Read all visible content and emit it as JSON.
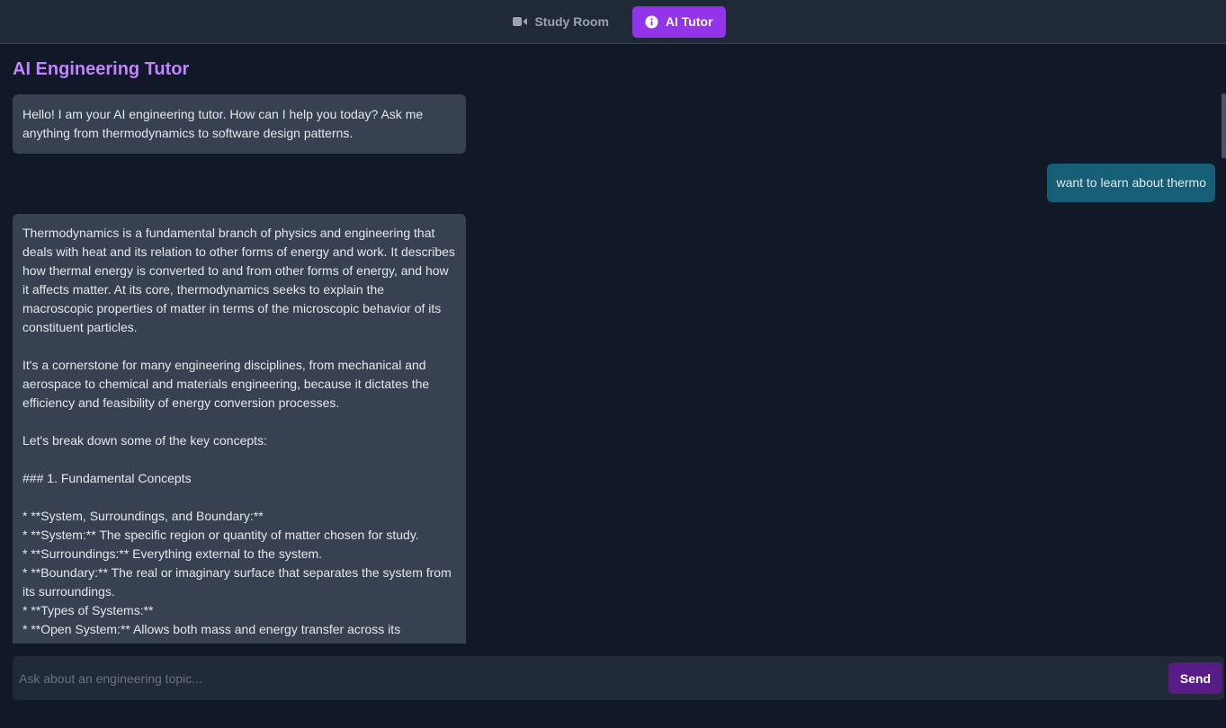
{
  "nav": {
    "tabs": [
      {
        "label": "Study Room",
        "icon": "video-camera-icon",
        "active": false
      },
      {
        "label": "AI Tutor",
        "icon": "info-circle-icon",
        "active": true
      }
    ]
  },
  "page": {
    "title": "AI Engineering Tutor"
  },
  "messages": [
    {
      "role": "assistant",
      "text": "Hello! I am your AI engineering tutor. How can I help you today? Ask me anything from thermodynamics to software design patterns."
    },
    {
      "role": "user",
      "text": "want to learn about thermo"
    },
    {
      "role": "assistant",
      "paragraphs": [
        "Thermodynamics is a fundamental branch of physics and engineering that deals with heat and its relation to other forms of energy and work. It describes how thermal energy is converted to and from other forms of energy, and how it affects matter. At its core, thermodynamics seeks to explain the macroscopic properties of matter in terms of the microscopic behavior of its constituent particles.",
        "It's a cornerstone for many engineering disciplines, from mechanical and aerospace to chemical and materials engineering, because it dictates the efficiency and feasibility of energy conversion processes.",
        "Let's break down some of the key concepts:",
        "### 1. Fundamental Concepts",
        "* **System, Surroundings, and Boundary:**\n* **System:** The specific region or quantity of matter chosen for study.\n* **Surroundings:** Everything external to the system.\n* **Boundary:** The real or imaginary surface that separates the system from its surroundings.\n* **Types of Systems:**\n* **Open System:** Allows both mass and energy transfer across its boundary"
      ]
    }
  ],
  "composer": {
    "placeholder": "Ask about an engineering topic...",
    "value": "",
    "send_label": "Send"
  },
  "colors": {
    "accent": "#9333ea",
    "title": "#c084fc",
    "user_bubble": "#155e75",
    "bot_bubble": "#374151",
    "send_button": "#581c87"
  }
}
